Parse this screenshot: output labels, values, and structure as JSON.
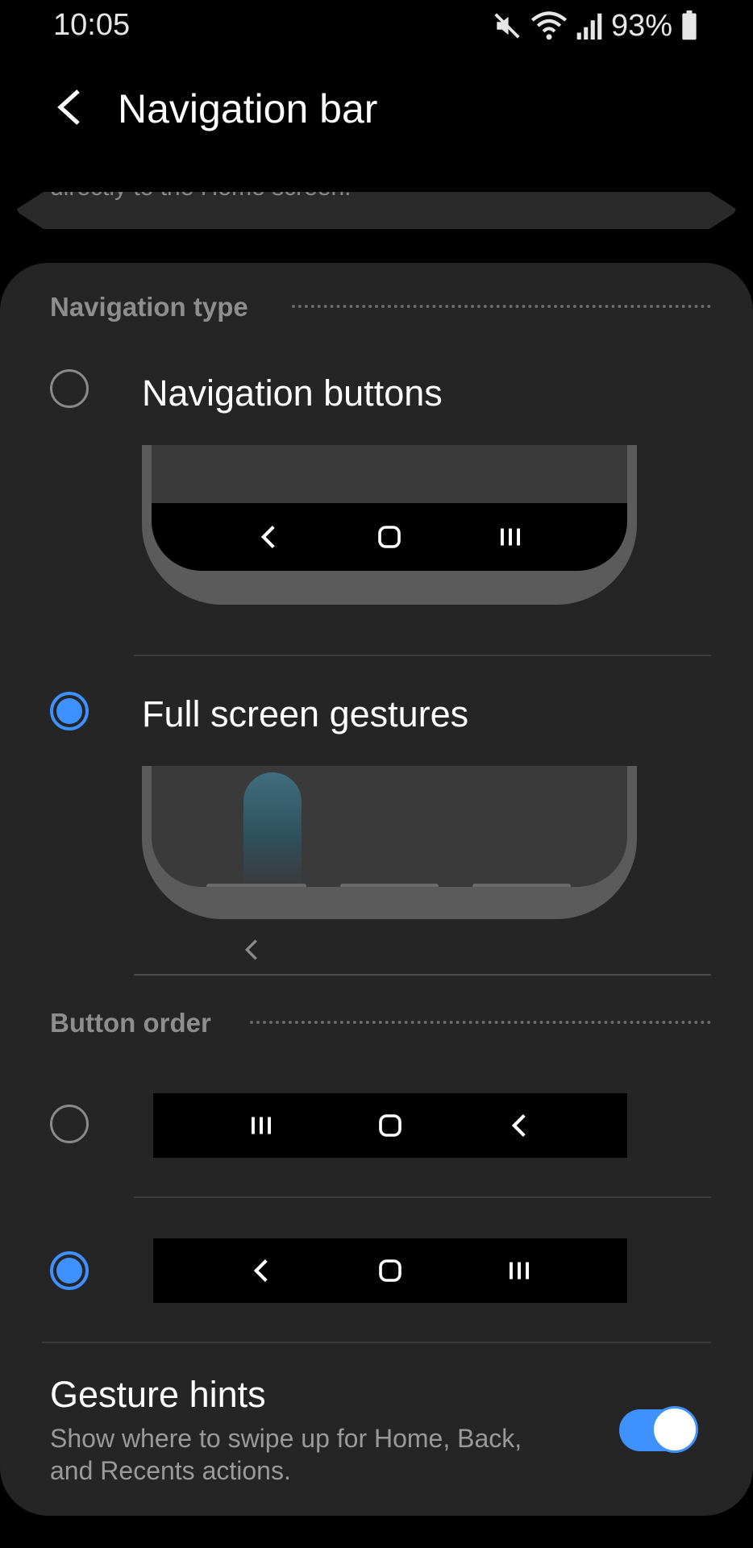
{
  "status_bar": {
    "time": "10:05",
    "battery": "93%",
    "icons": [
      "mute-icon",
      "wifi-icon",
      "signal-icon",
      "battery-icon"
    ]
  },
  "header": {
    "title": "Navigation bar",
    "back_icon": "chevron-left-icon"
  },
  "peek_card": {
    "text": "directly to the Home screen."
  },
  "navigation_type": {
    "header": "Navigation type",
    "options": [
      {
        "label": "Navigation buttons",
        "selected": false
      },
      {
        "label": "Full screen gestures",
        "selected": true
      }
    ]
  },
  "button_order": {
    "header": "Button order",
    "options": [
      {
        "order": [
          "recents-icon",
          "home-icon",
          "back-icon"
        ],
        "selected": false
      },
      {
        "order": [
          "back-icon",
          "home-icon",
          "recents-icon"
        ],
        "selected": true
      }
    ]
  },
  "gesture_hints": {
    "title": "Gesture hints",
    "description": "Show where to swipe up for Home, Back, and Recents actions.",
    "enabled": true
  },
  "colors": {
    "accent": "#3e91ff",
    "card_bg": "#252525",
    "background": "#000000"
  }
}
